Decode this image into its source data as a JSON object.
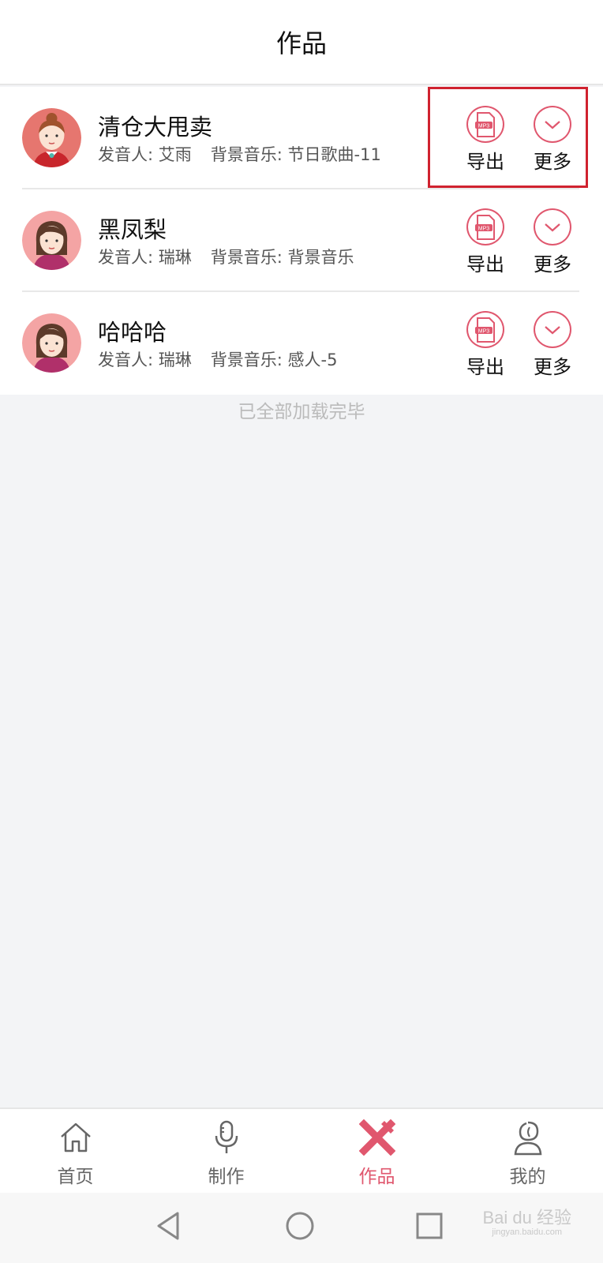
{
  "header": {
    "title": "作品"
  },
  "works": [
    {
      "name": "清仓大甩卖",
      "speaker_label": "发音人:",
      "speaker": "艾雨",
      "bgm_label": "背景音乐:",
      "bgm": "节日歌曲-11",
      "export_label": "导出",
      "more_label": "更多"
    },
    {
      "name": "黑凤梨",
      "speaker_label": "发音人:",
      "speaker": "瑞琳",
      "bgm_label": "背景音乐:",
      "bgm": "背景音乐",
      "export_label": "导出",
      "more_label": "更多"
    },
    {
      "name": "哈哈哈",
      "speaker_label": "发音人:",
      "speaker": "瑞琳",
      "bgm_label": "背景音乐:",
      "bgm": "感人-5",
      "export_label": "导出",
      "more_label": "更多"
    }
  ],
  "mp3_badge": "MP3",
  "list_end_text": "已全部加载完毕",
  "tabbar": {
    "tabs": [
      {
        "label": "首页",
        "icon": "home-icon",
        "active": false
      },
      {
        "label": "制作",
        "icon": "microphone-icon",
        "active": false
      },
      {
        "label": "作品",
        "icon": "works-icon",
        "active": true
      },
      {
        "label": "我的",
        "icon": "profile-icon",
        "active": false
      }
    ]
  },
  "watermark": {
    "main": "Bai du 经验",
    "sub": "jingyan.baidu.com"
  },
  "colors": {
    "accent": "#e0576e",
    "highlight_border": "#d0222f",
    "background": "#f3f4f6"
  }
}
